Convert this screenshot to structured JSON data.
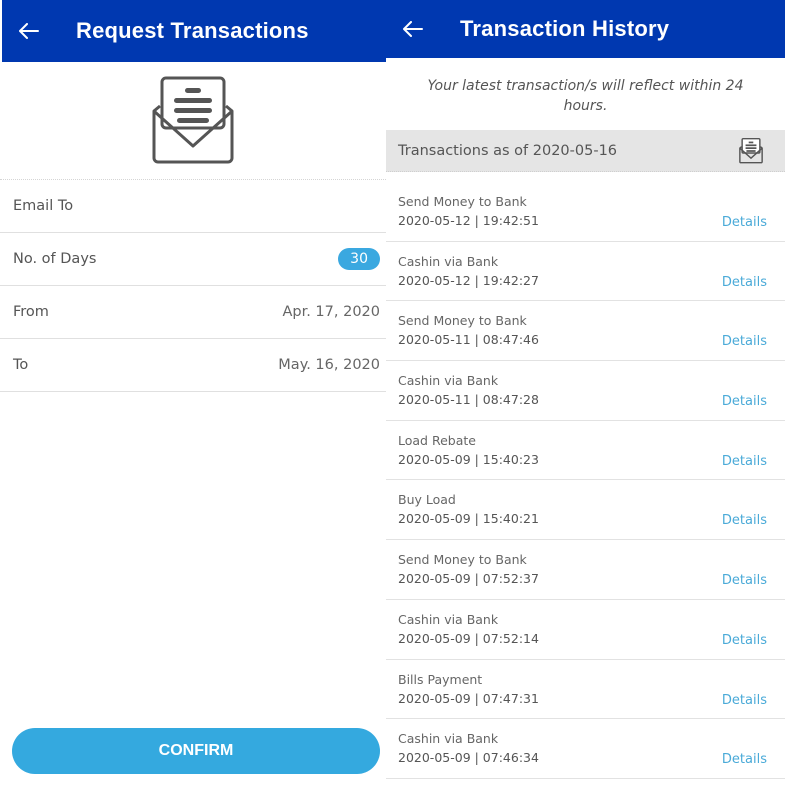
{
  "request_screen": {
    "title": "Request Transactions",
    "back_icon": "arrow-left-icon",
    "hero_icon": "envelope-document-icon",
    "fields": [
      {
        "label": "Email To",
        "value": ""
      },
      {
        "label": "No. of Days",
        "value": "30"
      },
      {
        "label": "From",
        "value": "Apr. 17, 2020"
      },
      {
        "label": "To",
        "value": "May. 16, 2020"
      }
    ],
    "confirm_label": "CONFIRM"
  },
  "history_screen": {
    "title": "Transaction History",
    "back_icon": "arrow-left-icon",
    "notice": "Your latest transaction/s will reflect within 24 hours.",
    "as_of_label": "Transactions as of 2020-05-16",
    "email_icon": "envelope-document-icon",
    "transactions": [
      {
        "name": "Send Money to Bank",
        "timestamp": "2020-05-12 | 19:42:51",
        "action": "Details"
      },
      {
        "name": "Cashin via Bank",
        "timestamp": "2020-05-12 | 19:42:27",
        "action": "Details"
      },
      {
        "name": "Send Money to Bank",
        "timestamp": "2020-05-11 | 08:47:46",
        "action": "Details"
      },
      {
        "name": "Cashin via Bank",
        "timestamp": "2020-05-11 | 08:47:28",
        "action": "Details"
      },
      {
        "name": "Load Rebate",
        "timestamp": "2020-05-09 | 15:40:23",
        "action": "Details"
      },
      {
        "name": "Buy Load",
        "timestamp": "2020-05-09 | 15:40:21",
        "action": "Details"
      },
      {
        "name": "Send Money to Bank",
        "timestamp": "2020-05-09 | 07:52:37",
        "action": "Details"
      },
      {
        "name": "Cashin via Bank",
        "timestamp": "2020-05-09 | 07:52:14",
        "action": "Details"
      },
      {
        "name": "Bills Payment",
        "timestamp": "2020-05-09 | 07:47:31",
        "action": "Details"
      },
      {
        "name": "Cashin via Bank",
        "timestamp": "2020-05-09 | 07:46:34",
        "action": "Details"
      }
    ]
  },
  "colors": {
    "header_blue": "#0038b0",
    "accent_blue": "#34a9df",
    "link_blue": "#4aaad8"
  }
}
